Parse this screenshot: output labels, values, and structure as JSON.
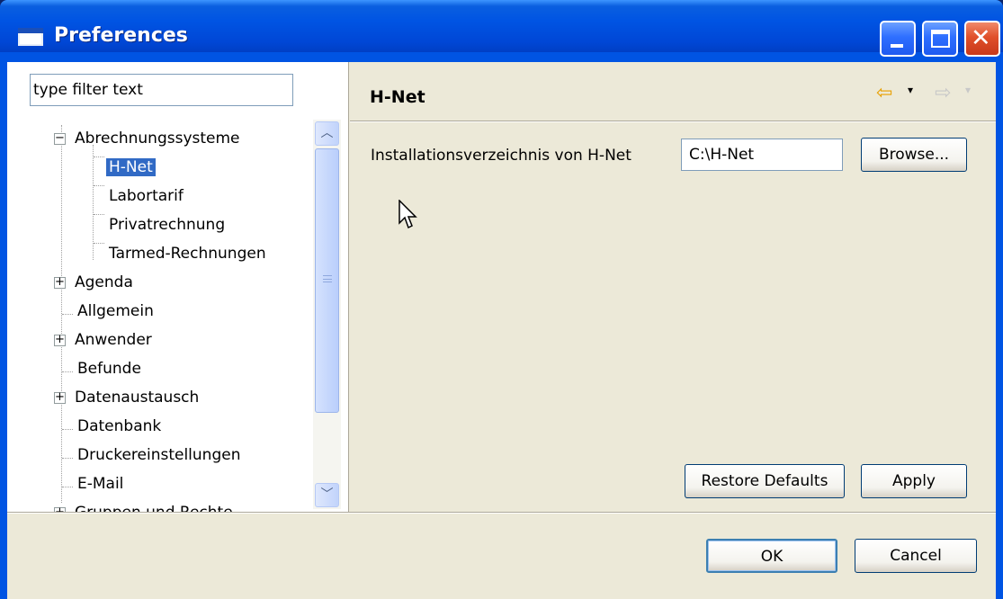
{
  "window": {
    "title": "Preferences"
  },
  "titlebar_buttons": {
    "minimize": "minimize-icon",
    "maximize": "maximize-icon",
    "close": "close-icon"
  },
  "filter": {
    "value": "type filter text"
  },
  "tree": {
    "items": [
      {
        "label": "Abrechnungssysteme",
        "expander": "⊟"
      },
      {
        "label": "H-Net"
      },
      {
        "label": "Labortarif"
      },
      {
        "label": "Privatrechnung"
      },
      {
        "label": "Tarmed-Rechnungen"
      },
      {
        "label": "Agenda",
        "expander": "⊞"
      },
      {
        "label": "Allgemein"
      },
      {
        "label": "Anwender",
        "expander": "⊞"
      },
      {
        "label": "Befunde"
      },
      {
        "label": "Datenaustausch",
        "expander": "⊞"
      },
      {
        "label": "Datenbank"
      },
      {
        "label": "Druckereinstellungen"
      },
      {
        "label": "E-Mail"
      },
      {
        "label": "Gruppen und Rechte",
        "expander": "⊞"
      }
    ],
    "selected": "H-Net"
  },
  "page": {
    "title": "H-Net",
    "field_label": "Installationsverzeichnis von H-Net",
    "field_value": "C:\\H-Net",
    "browse": "Browse...",
    "restore": "Restore Defaults",
    "apply": "Apply"
  },
  "footer": {
    "ok": "OK",
    "cancel": "Cancel"
  },
  "colors": {
    "titlebar": "#0054e3",
    "selection": "#316ac5",
    "dialog_bg": "#ece9d8"
  }
}
